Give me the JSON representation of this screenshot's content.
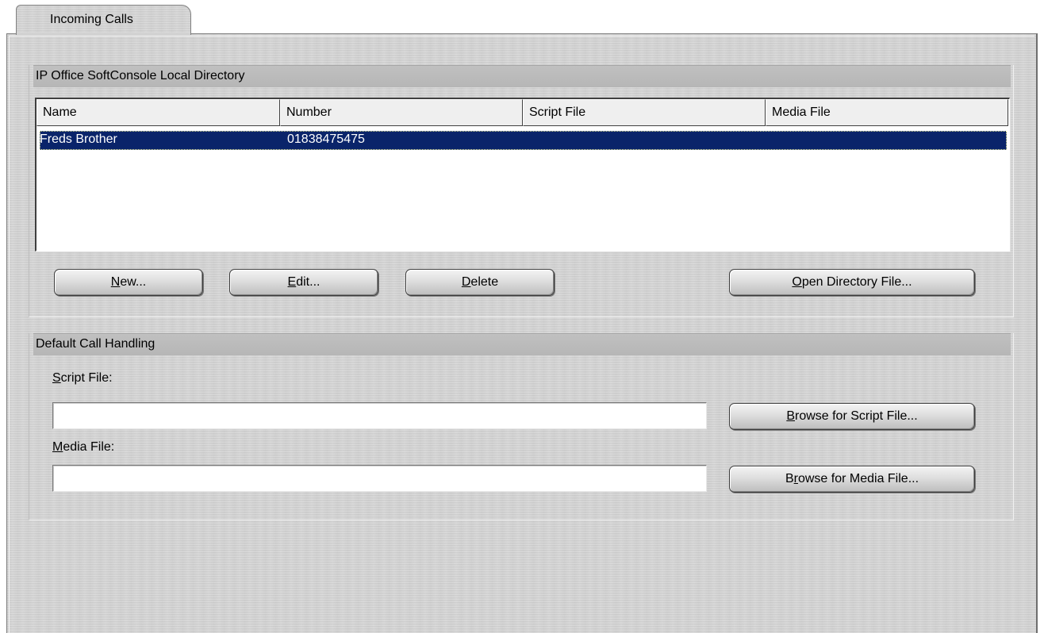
{
  "tab": {
    "label": "Incoming Calls"
  },
  "directory": {
    "header": "IP Office SoftConsole Local Directory",
    "columns": [
      "Name",
      "Number",
      "Script File",
      "Media File"
    ],
    "rows": [
      {
        "name": "Freds Brother",
        "number": "01838475475",
        "script_file": "",
        "media_file": "",
        "selected": true
      }
    ],
    "buttons": {
      "new": {
        "pre": "",
        "key": "N",
        "post": "ew..."
      },
      "edit": {
        "pre": "",
        "key": "E",
        "post": "dit..."
      },
      "delete": {
        "pre": "",
        "key": "D",
        "post": "elete"
      },
      "open": {
        "pre": "",
        "key": "O",
        "post": "pen Directory File..."
      }
    }
  },
  "default_handling": {
    "header": "Default Call Handling",
    "script_label": {
      "pre": "",
      "key": "S",
      "post": "cript File:"
    },
    "script_value": "",
    "media_label": {
      "pre": "",
      "key": "M",
      "post": "edia File:"
    },
    "media_value": "",
    "browse_script": {
      "pre": "",
      "key": "B",
      "post": "rowse for Script File..."
    },
    "browse_media": {
      "pre": "B",
      "key": "r",
      "post": "owse for Media File..."
    }
  },
  "colors": {
    "panel": "#d2d2d2",
    "section_header": "#bababa",
    "selection": "#0a246a",
    "selection_text": "#ffffff"
  }
}
